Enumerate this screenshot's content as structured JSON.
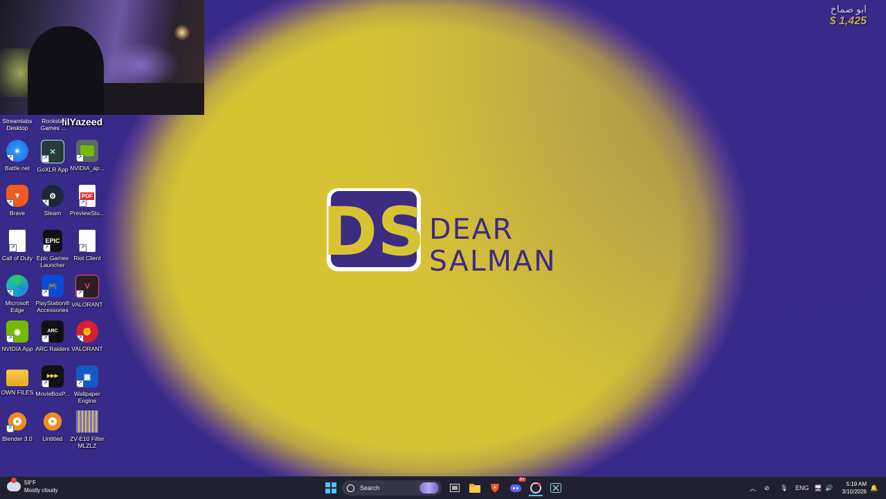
{
  "overlay": {
    "streamer_name": "lilYazeed",
    "top_right_name": "ابو صماخ",
    "top_right_amount": "$ 1,425"
  },
  "wallpaper": {
    "logo_initials": "DS",
    "logo_line1": "DEAR",
    "logo_line2": "SALMAN",
    "colors": {
      "yellow": "#d8c335",
      "purple": "#3c2c82"
    }
  },
  "desktop_icons": {
    "partial_row": {
      "streamlabs": "Streamlabs Desktop",
      "rockstar": "Rockstar Games ..."
    },
    "battlenet": "Battle.net",
    "goxlr": "GoXLR App",
    "nvidia_app_sc": "NVIDIA_ap...",
    "brave": "Brave",
    "steam": "Steam",
    "previewstudio": "PreviewStu...",
    "callofduty": "Call of Duty",
    "epic": "Epic Games Launcher",
    "riot": "Riot Client",
    "edge": "Microsoft Edge",
    "ps_accessories": "PlayStation® Accessories",
    "valorant1": "VALORANT",
    "nvidia_app": "NVIDIA App",
    "arc_raiders": "ARC Raiders",
    "valorant2": "VALORANT",
    "own_files": "OWN FILES",
    "movieboxpro": "MovieBoxP...",
    "wallpaper_engine": "Wallpaper Engine",
    "blender": "Blender 3.0",
    "untitled": "Untitled",
    "zv_filter": "ZV-E10 Filter MLZLZ"
  },
  "taskbar": {
    "weather_temp": "59°F",
    "weather_desc": "Mostly cloudy",
    "search_placeholder": "Search",
    "notif_badge": "9+",
    "language": "ENG",
    "time": "5:19 AM",
    "date": "3/10/2026"
  }
}
